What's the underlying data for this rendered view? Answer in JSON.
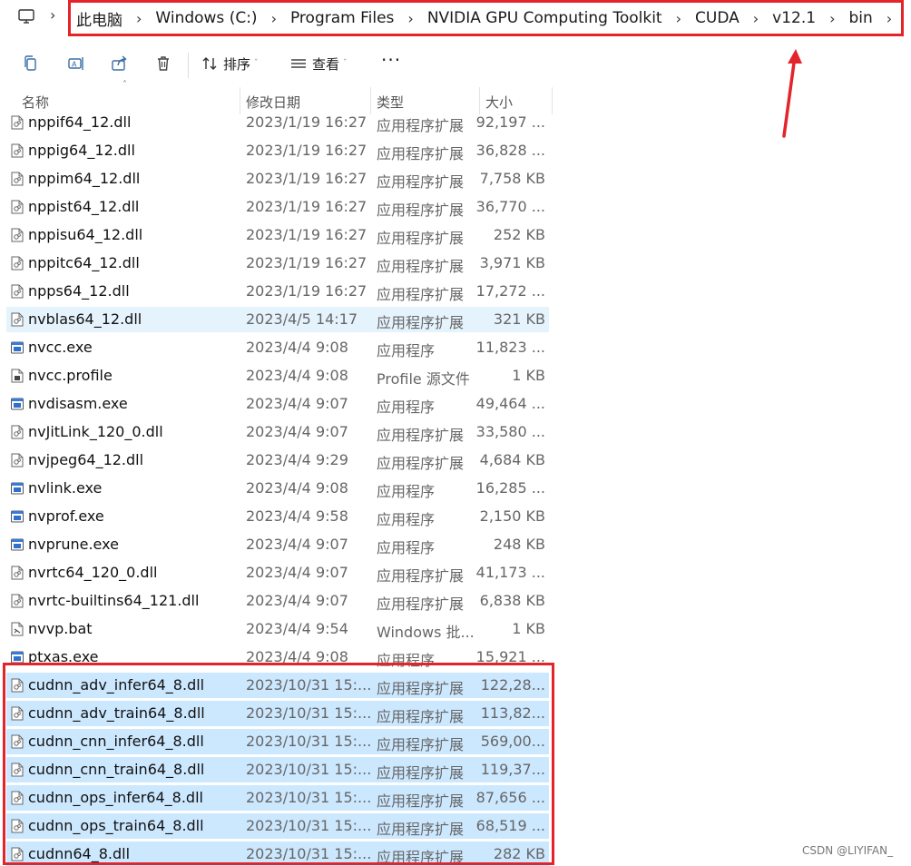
{
  "breadcrumb": {
    "segments": [
      "此电脑",
      "Windows (C:)",
      "Program Files",
      "NVIDIA GPU Computing Toolkit",
      "CUDA",
      "v12.1",
      "bin"
    ]
  },
  "toolbar": {
    "sort_label": "排序",
    "view_label": "查看",
    "more_label": "···"
  },
  "columns": {
    "name": "名称",
    "date": "修改日期",
    "type": "类型",
    "size": "大小"
  },
  "files": [
    {
      "name": "nppif64_12.dll",
      "date": "2023/1/19 16:27",
      "type": "应用程序扩展",
      "size": "92,197 ...",
      "icon": "dll",
      "state": "normal"
    },
    {
      "name": "nppig64_12.dll",
      "date": "2023/1/19 16:27",
      "type": "应用程序扩展",
      "size": "36,828 ...",
      "icon": "dll",
      "state": "normal"
    },
    {
      "name": "nppim64_12.dll",
      "date": "2023/1/19 16:27",
      "type": "应用程序扩展",
      "size": "7,758 KB",
      "icon": "dll",
      "state": "normal"
    },
    {
      "name": "nppist64_12.dll",
      "date": "2023/1/19 16:27",
      "type": "应用程序扩展",
      "size": "36,770 ...",
      "icon": "dll",
      "state": "normal"
    },
    {
      "name": "nppisu64_12.dll",
      "date": "2023/1/19 16:27",
      "type": "应用程序扩展",
      "size": "252 KB",
      "icon": "dll",
      "state": "normal"
    },
    {
      "name": "nppitc64_12.dll",
      "date": "2023/1/19 16:27",
      "type": "应用程序扩展",
      "size": "3,971 KB",
      "icon": "dll",
      "state": "normal"
    },
    {
      "name": "npps64_12.dll",
      "date": "2023/1/19 16:27",
      "type": "应用程序扩展",
      "size": "17,272 ...",
      "icon": "dll",
      "state": "normal"
    },
    {
      "name": "nvblas64_12.dll",
      "date": "2023/4/5 14:17",
      "type": "应用程序扩展",
      "size": "321 KB",
      "icon": "dll",
      "state": "hover"
    },
    {
      "name": "nvcc.exe",
      "date": "2023/4/4 9:08",
      "type": "应用程序",
      "size": "11,823 ...",
      "icon": "exe",
      "state": "normal"
    },
    {
      "name": "nvcc.profile",
      "date": "2023/4/4 9:08",
      "type": "Profile 源文件",
      "size": "1 KB",
      "icon": "profile",
      "state": "normal"
    },
    {
      "name": "nvdisasm.exe",
      "date": "2023/4/4 9:07",
      "type": "应用程序",
      "size": "49,464 ...",
      "icon": "exe",
      "state": "normal"
    },
    {
      "name": "nvJitLink_120_0.dll",
      "date": "2023/4/4 9:07",
      "type": "应用程序扩展",
      "size": "33,580 ...",
      "icon": "dll",
      "state": "normal"
    },
    {
      "name": "nvjpeg64_12.dll",
      "date": "2023/4/4 9:29",
      "type": "应用程序扩展",
      "size": "4,684 KB",
      "icon": "dll",
      "state": "normal"
    },
    {
      "name": "nvlink.exe",
      "date": "2023/4/4 9:08",
      "type": "应用程序",
      "size": "16,285 ...",
      "icon": "exe",
      "state": "normal"
    },
    {
      "name": "nvprof.exe",
      "date": "2023/4/4 9:58",
      "type": "应用程序",
      "size": "2,150 KB",
      "icon": "exe",
      "state": "normal"
    },
    {
      "name": "nvprune.exe",
      "date": "2023/4/4 9:07",
      "type": "应用程序",
      "size": "248 KB",
      "icon": "exe",
      "state": "normal"
    },
    {
      "name": "nvrtc64_120_0.dll",
      "date": "2023/4/4 9:07",
      "type": "应用程序扩展",
      "size": "41,173 ...",
      "icon": "dll",
      "state": "normal"
    },
    {
      "name": "nvrtc-builtins64_121.dll",
      "date": "2023/4/4 9:07",
      "type": "应用程序扩展",
      "size": "6,838 KB",
      "icon": "dll",
      "state": "normal"
    },
    {
      "name": "nvvp.bat",
      "date": "2023/4/4 9:54",
      "type": "Windows 批...",
      "size": "1 KB",
      "icon": "bat",
      "state": "normal"
    },
    {
      "name": "ptxas.exe",
      "date": "2023/4/4 9:08",
      "type": "应用程序",
      "size": "15,921 ...",
      "icon": "exe",
      "state": "normal"
    },
    {
      "name": "cudnn_adv_infer64_8.dll",
      "date": "2023/10/31 15:...",
      "type": "应用程序扩展",
      "size": "122,28...",
      "icon": "dll",
      "state": "selected"
    },
    {
      "name": "cudnn_adv_train64_8.dll",
      "date": "2023/10/31 15:...",
      "type": "应用程序扩展",
      "size": "113,82...",
      "icon": "dll",
      "state": "selected"
    },
    {
      "name": "cudnn_cnn_infer64_8.dll",
      "date": "2023/10/31 15:...",
      "type": "应用程序扩展",
      "size": "569,00...",
      "icon": "dll",
      "state": "selected"
    },
    {
      "name": "cudnn_cnn_train64_8.dll",
      "date": "2023/10/31 15:...",
      "type": "应用程序扩展",
      "size": "119,37...",
      "icon": "dll",
      "state": "selected"
    },
    {
      "name": "cudnn_ops_infer64_8.dll",
      "date": "2023/10/31 15:...",
      "type": "应用程序扩展",
      "size": "87,656 ...",
      "icon": "dll",
      "state": "selected"
    },
    {
      "name": "cudnn_ops_train64_8.dll",
      "date": "2023/10/31 15:...",
      "type": "应用程序扩展",
      "size": "68,519 ...",
      "icon": "dll",
      "state": "selected"
    },
    {
      "name": "cudnn64_8.dll",
      "date": "2023/10/31 15:...",
      "type": "应用程序扩展",
      "size": "282 KB",
      "icon": "dll",
      "state": "selected"
    }
  ],
  "watermark": "CSDN @LIYIFAN_",
  "colors": {
    "annotation_red": "#e3242b",
    "selected_bg": "#cce8ff",
    "hover_bg": "#e5f3fd"
  }
}
